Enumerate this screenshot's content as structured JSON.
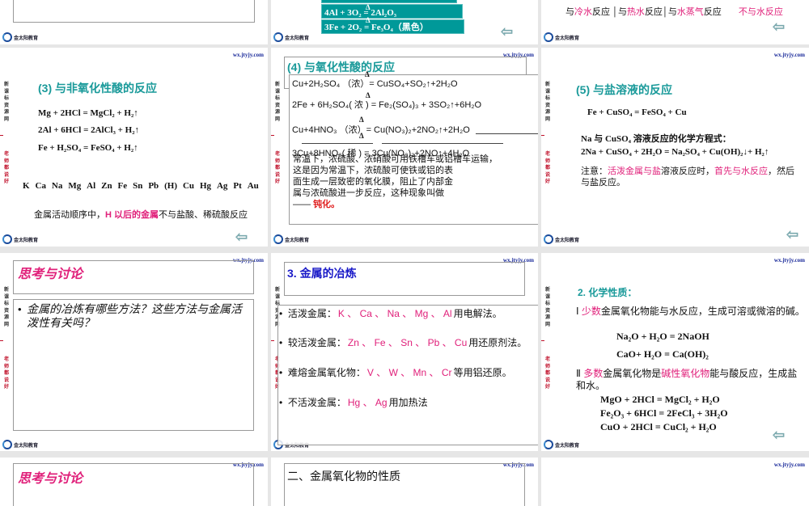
{
  "common": {
    "url": "wx.jtyjy.com",
    "side_a": "新课标资源网",
    "side_b": "老师都说好",
    "logo": "金太阳教育",
    "back_icon": "left-arrow-icon"
  },
  "colors": {
    "teal": "#1a9a9a",
    "pink": "#e0207a",
    "box": "#009999",
    "blue": "#1a1ac8"
  },
  "row0": {
    "mid_boxes": [
      "4Al + 3O₂ = 2Al₂O₃",
      "3Fe + 2O₂ = Fe₃O₄（黑色）"
    ],
    "delta": "Δ",
    "water": [
      "与",
      "冷水",
      "反应",
      "与",
      "热水",
      "反应",
      "与",
      "水蒸气",
      "反应",
      "不与水反应"
    ]
  },
  "s3": {
    "title": "(3) 与非氧化性酸的反应",
    "eqs": [
      "Mg + 2HCl = MgCl₂ + H₂↑",
      "2Al + 6HCl = 2AlCl₃ + H₂↑",
      "Fe + H₂SO₄ =  FeSO₄ + H₂↑"
    ],
    "metals": [
      "K",
      "Ca",
      "Na",
      "Mg",
      "Al",
      "Zn",
      "Fe",
      "Sn",
      "Pb",
      "(H)",
      "Cu",
      "Hg",
      "Ag",
      "Pt",
      "Au"
    ],
    "note_a": "金属活动顺序中，",
    "note_b": "H 以后的金属",
    "note_c": "不与盐酸、稀硫酸反应"
  },
  "s4": {
    "title": "(4) 与氧化性酸的反应",
    "delta": "Δ",
    "eqs": [
      "Cu+2H₂SO₄ （浓）= CuSO₄+SO₂↑+2H₂O",
      "2Fe + 6H₂SO₄( 浓 ) =  Fe₂(SO₄)₃ + 3SO₂↑+6H₂O",
      "Cu+4HNO₃ （浓）=  Cu(NO₃)₂+2NO₂↑+2H₂O",
      "3Cu+8HNO₃( 稀 ) =  3Cu(NO₃)₂+2NO↑+4H₂O"
    ],
    "para": [
      "常温下，浓硫酸、浓硝酸可用铁槽车或铝槽车运输，",
      "这是因为常温下，浓硫酸可使铁或铝的表",
      "面生成一层致密的氧化膜，阻止了内部金",
      "属与浓硫酸进一步反应，这种现象叫做"
    ],
    "dash": "—— ",
    "term": "钝化。"
  },
  "s5": {
    "title": "(5) 与盐溶液的反应",
    "eq1": "Fe + CuSO₄ = FeSO₄ + Cu",
    "q": "Na 与 CuSO₄ 溶液反应的化学方程式：",
    "eq2": "2Na + CuSO₄ + 2H₂O = Na₂SO₄ + Cu(OH)₂↓+ H₂↑",
    "note": [
      "注意：",
      "活泼金属与盐",
      "溶液反应时，",
      "首先与水反应",
      "，然后与盐反应。"
    ]
  },
  "think1": {
    "title": "思考与讨论",
    "bullet": "金属的冶炼有哪些方法？这些方法与金属活泼性有关吗？"
  },
  "smelt": {
    "title": "3. 金属的冶炼",
    "items": [
      {
        "label": "活泼金属：",
        "metals": "K 、 Ca 、  Na 、 Mg 、 Al",
        "method": "用电解法。"
      },
      {
        "label": "较活泼金属：",
        "metals": "Zn 、 Fe 、 Sn 、 Pb 、 Cu",
        "method": "用还原剂法。"
      },
      {
        "label": "难熔金属氧化物：",
        "metals": "V 、 W 、 Mn 、 Cr",
        "method": "等用铝还原。"
      },
      {
        "label": "不活泼金属：",
        "metals": "Hg 、 Ag",
        "method": "用加热法"
      }
    ]
  },
  "chem": {
    "title": "2. 化学性质：",
    "p1": [
      "Ⅰ   ",
      "少数",
      "金属氧化物能与水反应，生成可溶或微溶的碱。"
    ],
    "eq1": [
      "Na₂O + H₂O = 2NaOH",
      "CaO+ H₂O = Ca(OH)₂"
    ],
    "p2": [
      "Ⅱ    ",
      "多数",
      "金属氧化物是",
      "碱性氧化物",
      "能与酸反应，生成盐和水。"
    ],
    "eq2": [
      "MgO + 2HCl = MgCl₂ + H₂O",
      "Fe₂O₃ + 6HCl = 2FeCl₃ + 3H₂O",
      "CuO + 2HCl = CuCl₂ + H₂O"
    ]
  },
  "row3": {
    "think_title": "思考与讨论",
    "oxide_title": "二、金属氧化物的性质"
  }
}
